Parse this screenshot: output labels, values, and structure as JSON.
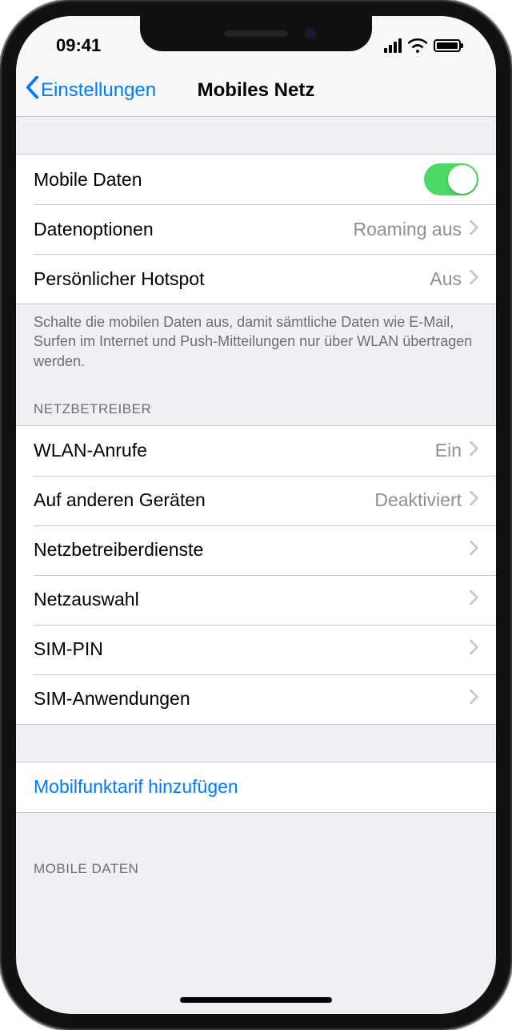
{
  "status": {
    "time": "09:41"
  },
  "nav": {
    "back_label": "Einstellungen",
    "title": "Mobiles Netz"
  },
  "section1": {
    "mobile_data_label": "Mobile Daten",
    "mobile_data_on": true,
    "data_options_label": "Datenoptionen",
    "data_options_value": "Roaming aus",
    "hotspot_label": "Persönlicher Hotspot",
    "hotspot_value": "Aus",
    "footer": "Schalte die mobilen Daten aus, damit sämtliche Daten wie E-Mail, Surfen im Internet und Push-Mitteilungen nur über WLAN übertragen werden."
  },
  "carrier": {
    "header": "NETZBETREIBER",
    "wifi_calls_label": "WLAN-Anrufe",
    "wifi_calls_value": "Ein",
    "other_devices_label": "Auf anderen Geräten",
    "other_devices_value": "Deaktiviert",
    "services_label": "Netzbetreiberdienste",
    "network_select_label": "Netzauswahl",
    "sim_pin_label": "SIM-PIN",
    "sim_apps_label": "SIM-Anwendungen"
  },
  "add_plan": {
    "label": "Mobilfunktarif hinzufügen"
  },
  "mobile_data_section": {
    "header": "MOBILE DATEN"
  }
}
